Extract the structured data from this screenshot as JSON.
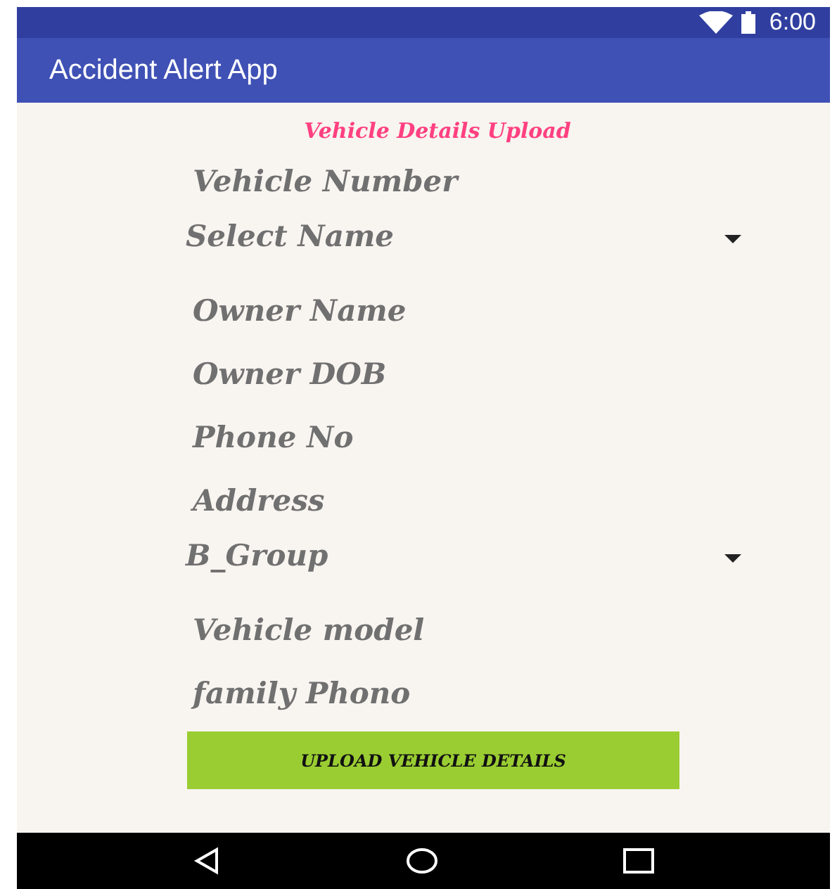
{
  "status_bar": {
    "time": "6:00"
  },
  "app_bar": {
    "title": "Accident Alert App"
  },
  "heading": "Vehicle Details Upload",
  "fields": [
    {
      "kind": "input",
      "placeholder": "Vehicle Number"
    },
    {
      "kind": "dropdown",
      "value": "Select Name"
    },
    {
      "kind": "input",
      "placeholder": "Owner Name"
    },
    {
      "kind": "input",
      "placeholder": "Owner DOB"
    },
    {
      "kind": "input",
      "placeholder": "Phone No"
    },
    {
      "kind": "input",
      "placeholder": "Address"
    },
    {
      "kind": "dropdown",
      "value": "B_Group"
    },
    {
      "kind": "input",
      "placeholder": "Vehicle model"
    },
    {
      "kind": "input",
      "placeholder": "family Phono"
    }
  ],
  "button": "UPLOAD VEHICLE DETAILS"
}
